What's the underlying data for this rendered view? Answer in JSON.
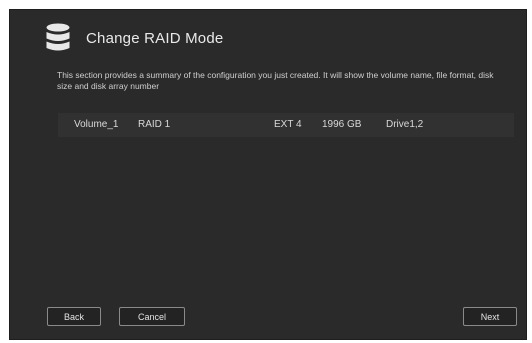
{
  "dialog": {
    "title": "Change RAID Mode",
    "icon": "database-icon",
    "description": "This section provides a summary of the configuration you just created. It will show the volume name, file format, disk size and disk array number"
  },
  "summary": {
    "volume": "Volume_1",
    "raid": "RAID 1",
    "file_system": "EXT 4",
    "size": "1996 GB",
    "drives": "Drive1,2"
  },
  "buttons": {
    "back": "Back",
    "cancel": "Cancel",
    "next": "Next"
  },
  "colors": {
    "background": "#2a2a2a",
    "row": "#313131",
    "text": "#e9e9e9"
  }
}
